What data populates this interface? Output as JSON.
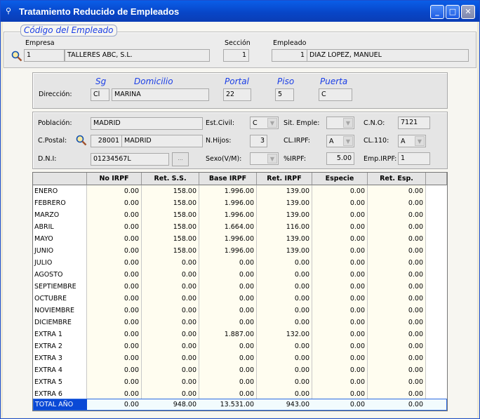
{
  "window": {
    "title": "Tratamiento Reducido de Empleados",
    "minimize": "_",
    "maximize": "□",
    "close": "✕"
  },
  "employee": {
    "section_title": "Código del Empleado",
    "empresa_label": "Empresa",
    "empresa_code": "1",
    "empresa_name": "TALLERES ABC, S.L.",
    "seccion_label": "Sección",
    "seccion_value": "1",
    "empleado_label": "Empleado",
    "empleado_code": "1",
    "empleado_name": "DIAZ  LOPEZ, MANUEL"
  },
  "address": {
    "sg_label": "Sg",
    "domicilio_label": "Domicilio",
    "portal_label": "Portal",
    "piso_label": "Piso",
    "puerta_label": "Puerta",
    "direccion_label": "Dirección:",
    "sg": "Cl",
    "domicilio": "MARINA",
    "portal": "22",
    "piso": "5",
    "puerta": "C"
  },
  "details": {
    "poblacion_label": "Población:",
    "poblacion": "MADRID",
    "cpostal_label": "C.Postal:",
    "cpostal_code": "28001",
    "cpostal_city": "MADRID",
    "dni_label": "D.N.I:",
    "dni": "01234567L",
    "dni_button": "...",
    "estcivil_label": "Est.Civil:",
    "estcivil": "C",
    "nhijos_label": "N.Hijos:",
    "nhijos": "3",
    "sexo_label": "Sexo(V/M):",
    "sexo": "",
    "sitemple_label": "Sit. Emple:",
    "sitemple": "",
    "clirpf_label": "CL.IRPF:",
    "clirpf": "A",
    "pirpf_label": "%IRPF:",
    "pirpf": "5.00",
    "cno_label": "C.N.O:",
    "cno": "7121",
    "cl110_label": "CL.110:",
    "cl110": "A",
    "empirpf_label": "Emp.IRPF:",
    "empirpf": "1"
  },
  "table": {
    "headers": [
      "No IRPF",
      "Ret. S.S.",
      "Base IRPF",
      "Ret. IRPF",
      "Especie",
      "Ret. Esp."
    ],
    "rows": [
      {
        "label": "ENERO",
        "v": [
          "0.00",
          "158.00",
          "1.996.00",
          "139.00",
          "0.00",
          "0.00"
        ]
      },
      {
        "label": "FEBRERO",
        "v": [
          "0.00",
          "158.00",
          "1.996.00",
          "139.00",
          "0.00",
          "0.00"
        ]
      },
      {
        "label": "MARZO",
        "v": [
          "0.00",
          "158.00",
          "1.996.00",
          "139.00",
          "0.00",
          "0.00"
        ]
      },
      {
        "label": "ABRIL",
        "v": [
          "0.00",
          "158.00",
          "1.664.00",
          "116.00",
          "0.00",
          "0.00"
        ]
      },
      {
        "label": "MAYO",
        "v": [
          "0.00",
          "158.00",
          "1.996.00",
          "139.00",
          "0.00",
          "0.00"
        ]
      },
      {
        "label": "JUNIO",
        "v": [
          "0.00",
          "158.00",
          "1.996.00",
          "139.00",
          "0.00",
          "0.00"
        ]
      },
      {
        "label": "JULIO",
        "v": [
          "0.00",
          "0.00",
          "0.00",
          "0.00",
          "0.00",
          "0.00"
        ]
      },
      {
        "label": "AGOSTO",
        "v": [
          "0.00",
          "0.00",
          "0.00",
          "0.00",
          "0.00",
          "0.00"
        ]
      },
      {
        "label": "SEPTIEMBRE",
        "v": [
          "0.00",
          "0.00",
          "0.00",
          "0.00",
          "0.00",
          "0.00"
        ]
      },
      {
        "label": "OCTUBRE",
        "v": [
          "0.00",
          "0.00",
          "0.00",
          "0.00",
          "0.00",
          "0.00"
        ]
      },
      {
        "label": "NOVIEMBRE",
        "v": [
          "0.00",
          "0.00",
          "0.00",
          "0.00",
          "0.00",
          "0.00"
        ]
      },
      {
        "label": "DICIEMBRE",
        "v": [
          "0.00",
          "0.00",
          "0.00",
          "0.00",
          "0.00",
          "0.00"
        ]
      },
      {
        "label": "EXTRA 1",
        "v": [
          "0.00",
          "0.00",
          "1.887.00",
          "132.00",
          "0.00",
          "0.00"
        ]
      },
      {
        "label": "EXTRA 2",
        "v": [
          "0.00",
          "0.00",
          "0.00",
          "0.00",
          "0.00",
          "0.00"
        ]
      },
      {
        "label": "EXTRA 3",
        "v": [
          "0.00",
          "0.00",
          "0.00",
          "0.00",
          "0.00",
          "0.00"
        ]
      },
      {
        "label": "EXTRA 4",
        "v": [
          "0.00",
          "0.00",
          "0.00",
          "0.00",
          "0.00",
          "0.00"
        ]
      },
      {
        "label": "EXTRA 5",
        "v": [
          "0.00",
          "0.00",
          "0.00",
          "0.00",
          "0.00",
          "0.00"
        ]
      },
      {
        "label": "EXTRA 6",
        "v": [
          "0.00",
          "0.00",
          "0.00",
          "0.00",
          "0.00",
          "0.00"
        ]
      }
    ],
    "total": {
      "label": "TOTAL AÑO",
      "v": [
        "0.00",
        "948.00",
        "13.531.00",
        "943.00",
        "0.00",
        "0.00"
      ]
    }
  },
  "icons": {
    "search": "magnifier-icon",
    "dropdown": "chevron-down-icon",
    "app": "app-icon"
  }
}
